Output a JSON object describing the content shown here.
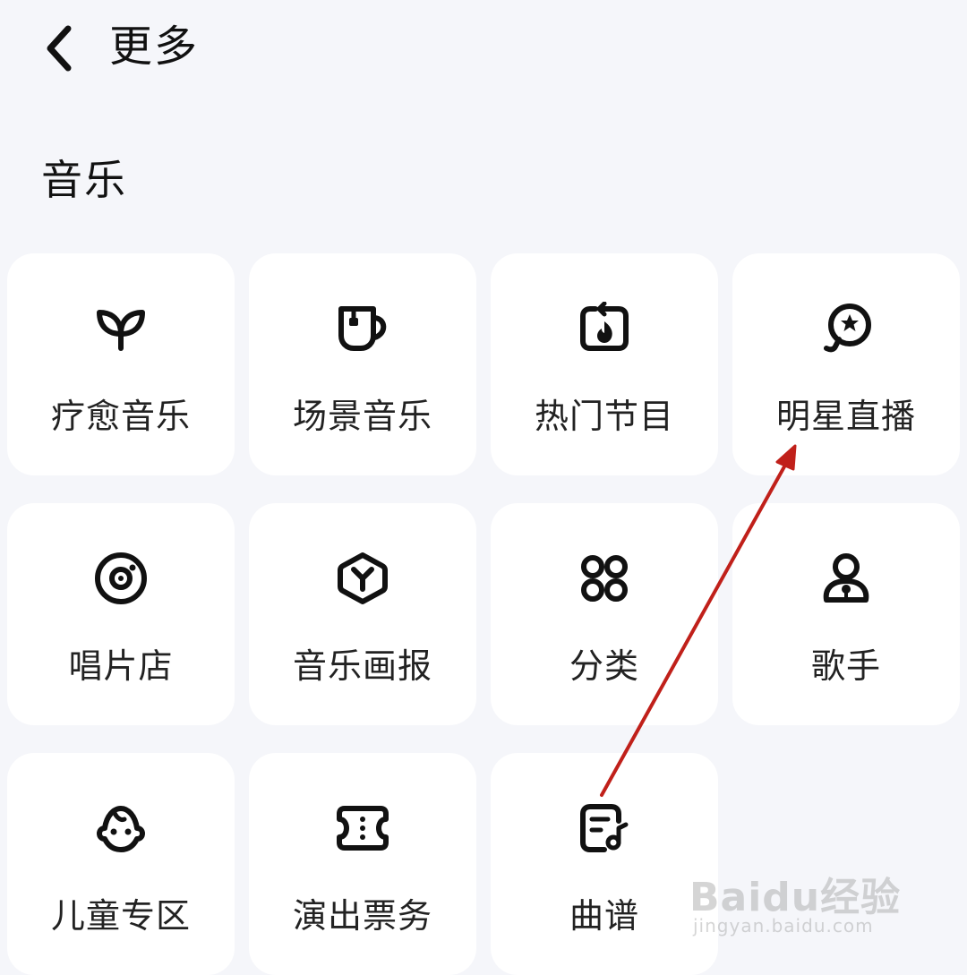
{
  "header": {
    "title": "更多"
  },
  "section": {
    "title": "音乐"
  },
  "grid": {
    "items": [
      {
        "label": "疗愈音乐",
        "icon": "sprout-icon"
      },
      {
        "label": "场景音乐",
        "icon": "cup-icon"
      },
      {
        "label": "热门节目",
        "icon": "flame-icon"
      },
      {
        "label": "明星直播",
        "icon": "star-bubble-icon"
      },
      {
        "label": "唱片店",
        "icon": "vinyl-icon"
      },
      {
        "label": "音乐画报",
        "icon": "hexagon-y-icon"
      },
      {
        "label": "分类",
        "icon": "grid-icon"
      },
      {
        "label": "歌手",
        "icon": "singer-icon"
      },
      {
        "label": "儿童专区",
        "icon": "child-face-icon"
      },
      {
        "label": "演出票务",
        "icon": "ticket-icon"
      },
      {
        "label": "曲谱",
        "icon": "sheet-music-icon"
      }
    ]
  },
  "annotation": {
    "color": "#c0201a"
  },
  "watermark": {
    "brand": "Baidu经验",
    "url": "jingyan.baidu.com"
  }
}
